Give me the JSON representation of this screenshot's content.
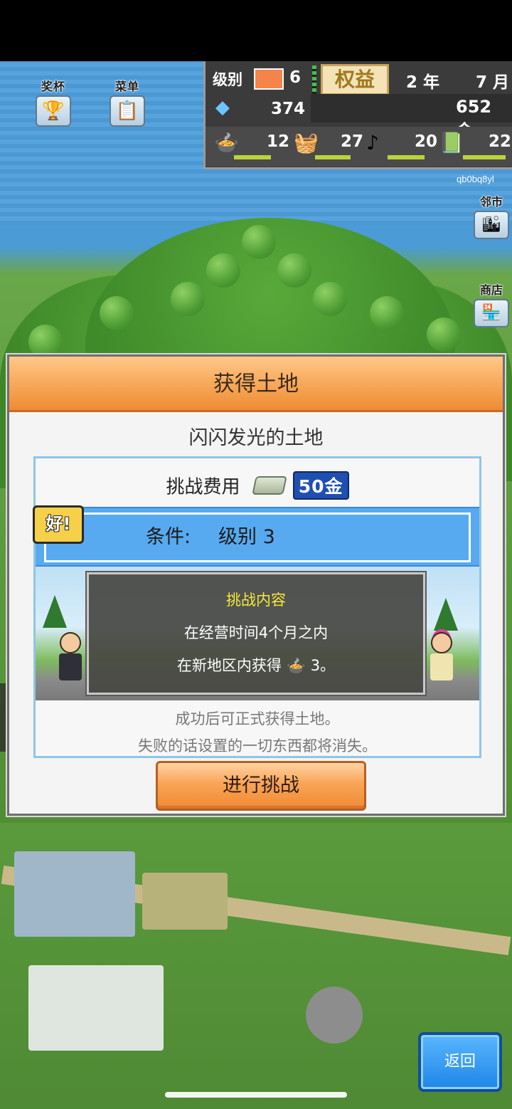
{
  "top_left": {
    "trophy_label": "奖杯",
    "menu_label": "菜单"
  },
  "hud": {
    "level_label": "级别",
    "level_value": "6",
    "rights_label": "权益",
    "year": "2 年",
    "month": "7 月",
    "gems": "374",
    "money": "652 金",
    "stats": [
      {
        "icon": "food-icon",
        "value": "12"
      },
      {
        "icon": "goods-icon",
        "value": "27"
      },
      {
        "icon": "music-icon",
        "value": "20"
      },
      {
        "icon": "book-icon",
        "value": "22"
      }
    ]
  },
  "player_code": "qb0bq8yl",
  "right_side": {
    "neighbor_label": "邻市",
    "shop_label": "商店"
  },
  "dialog": {
    "title": "获得土地",
    "subtitle": "闪闪发光的土地",
    "fee_label": "挑战费用",
    "fee_value": "50金",
    "ok_badge": "好!",
    "condition_label": "条件:",
    "condition_value": "级别 3",
    "challenge_title": "挑战内容",
    "challenge_line1": "在经营时间4个月之内",
    "challenge_line2_prefix": "在新地区内获得",
    "challenge_line2_suffix": "3。",
    "note1": "成功后可正式获得土地。",
    "note2": "失败的话设置的一切东西都将消失。",
    "go_button": "进行挑战"
  },
  "back_button": "返回",
  "colors": {
    "dialog_header": "#f6a657",
    "condition_bg": "#57aaf0",
    "challenge_title": "#f6ea3a",
    "back_button": "#1f86e6"
  }
}
